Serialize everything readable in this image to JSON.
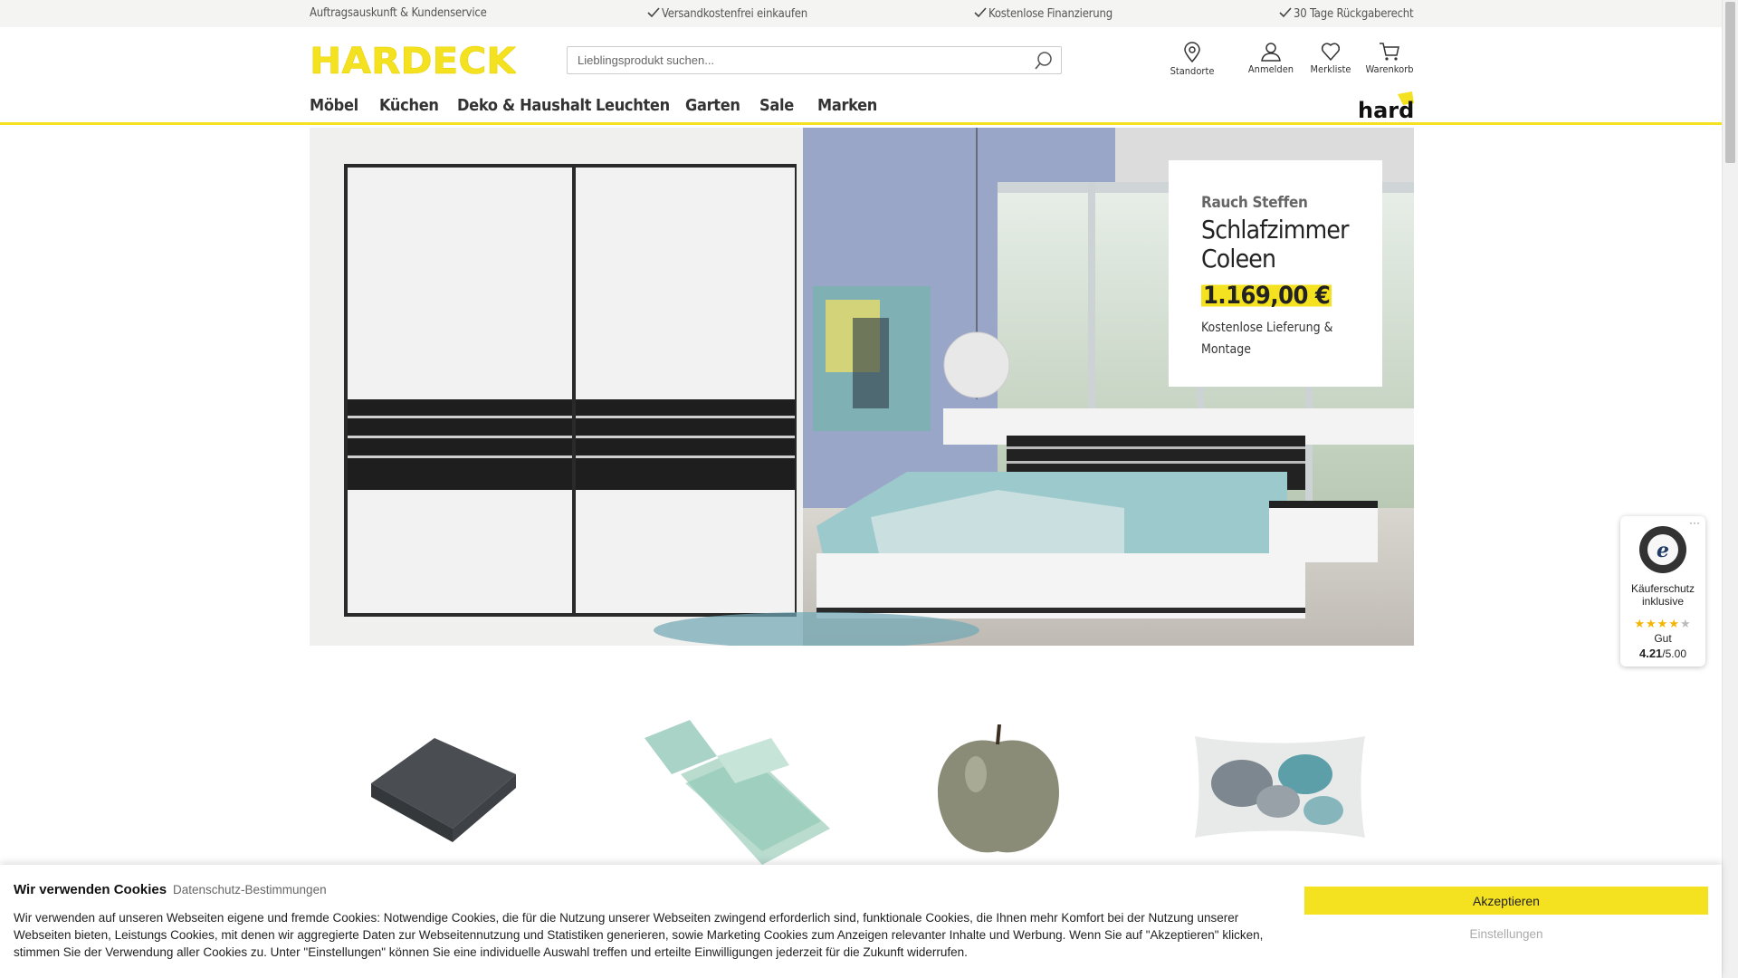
{
  "topbar": {
    "items": [
      {
        "label": "Auftragsauskunft & Kundenservice",
        "check": false
      },
      {
        "label": "Versandkostenfrei einkaufen",
        "check": true
      },
      {
        "label": "Kostenlose Finanzierung",
        "check": true
      },
      {
        "label": "30 Tage Rückgaberecht",
        "check": true
      }
    ]
  },
  "header": {
    "logo_text": "HARDECK",
    "search_placeholder": "Lieblingsprodukt suchen...",
    "icons": [
      {
        "label": "Standorte",
        "icon": "location-pin-icon"
      },
      {
        "label": "Anmelden",
        "icon": "user-icon"
      },
      {
        "label": "Merkliste",
        "icon": "heart-icon"
      },
      {
        "label": "Warenkorb",
        "icon": "cart-icon"
      }
    ],
    "brand_badge": "hardi"
  },
  "nav": {
    "items": [
      "Möbel",
      "Küchen",
      "Deko & Haushalt",
      "Leuchten",
      "Garten",
      "Sale",
      "Marken"
    ]
  },
  "hero": {
    "brand": "Rauch Steffen",
    "product_name": "Schlafzimmer Coleen",
    "price": "1.169,00 €",
    "note": "Kostenlose Lieferung & Montage"
  },
  "products": [
    {
      "name": "blanket-image"
    },
    {
      "name": "bedding-image"
    },
    {
      "name": "apple-decoration-image"
    },
    {
      "name": "cushion-image"
    }
  ],
  "trust_badge": {
    "seal_label": "TRUSTED SHOPS GUARANTEE",
    "title": "Käuferschutz inklusive",
    "rating_word": "Gut",
    "score": "4.21",
    "score_max": "/5.00",
    "stars_filled": 4,
    "stars_total": 5
  },
  "cookie": {
    "title": "Wir verwenden Cookies",
    "privacy_link": "Datenschutz-Bestimmungen",
    "text": "Wir verwenden auf unseren Webseiten eigene und fremde Cookies: Notwendige Cookies, die für die Nutzung unserer Webseiten zwingend erforderlich sind, funktionale Cookies, die Ihnen mehr Komfort bei der Nutzung unserer Webseiten bieten, Leistungs Cookies, mit denen wir aggregierte Daten zur Webseitennutzung und Statistiken generieren, sowie Marketing Cookies zum Anzeigen relevanter Inhalte und Werbung. Wenn Sie auf \"Akzeptieren\" klicken, stimmen Sie der Verwendung aller Cookies zu. Unter \"Einstellungen\" können Sie eine individuelle Auswahl treffen und erteilte Einwilligungen jederzeit für die Zukunft widerrufen.",
    "accept_label": "Akzeptieren",
    "settings_label": "Einstellungen"
  },
  "colors": {
    "brand_yellow": "#f4e11f",
    "text": "#333333",
    "topbar_bg": "#f4f4f2"
  }
}
